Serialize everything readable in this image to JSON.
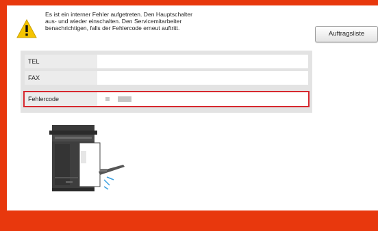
{
  "message": {
    "line1": "Es ist ein interner Fehler aufgetreten. Den Hauptschalter",
    "line2": "aus- und wieder einschalten. Den Servicemitarbeiter",
    "line3": "benachrichtigen, falls der Fehlercode erneut auftritt."
  },
  "buttons": {
    "job_list": "Auftragsliste"
  },
  "info": {
    "rows": [
      {
        "label": "TEL",
        "value": ""
      },
      {
        "label": "FAX",
        "value": ""
      },
      {
        "label": "Fehlercode",
        "value": ""
      }
    ]
  },
  "colors": {
    "accent": "#e8380d",
    "error_outline": "#d7282f",
    "warning": "#f5c400"
  },
  "icons": {
    "warning": "warning-triangle-icon",
    "device": "mfp-printer-illustration"
  }
}
